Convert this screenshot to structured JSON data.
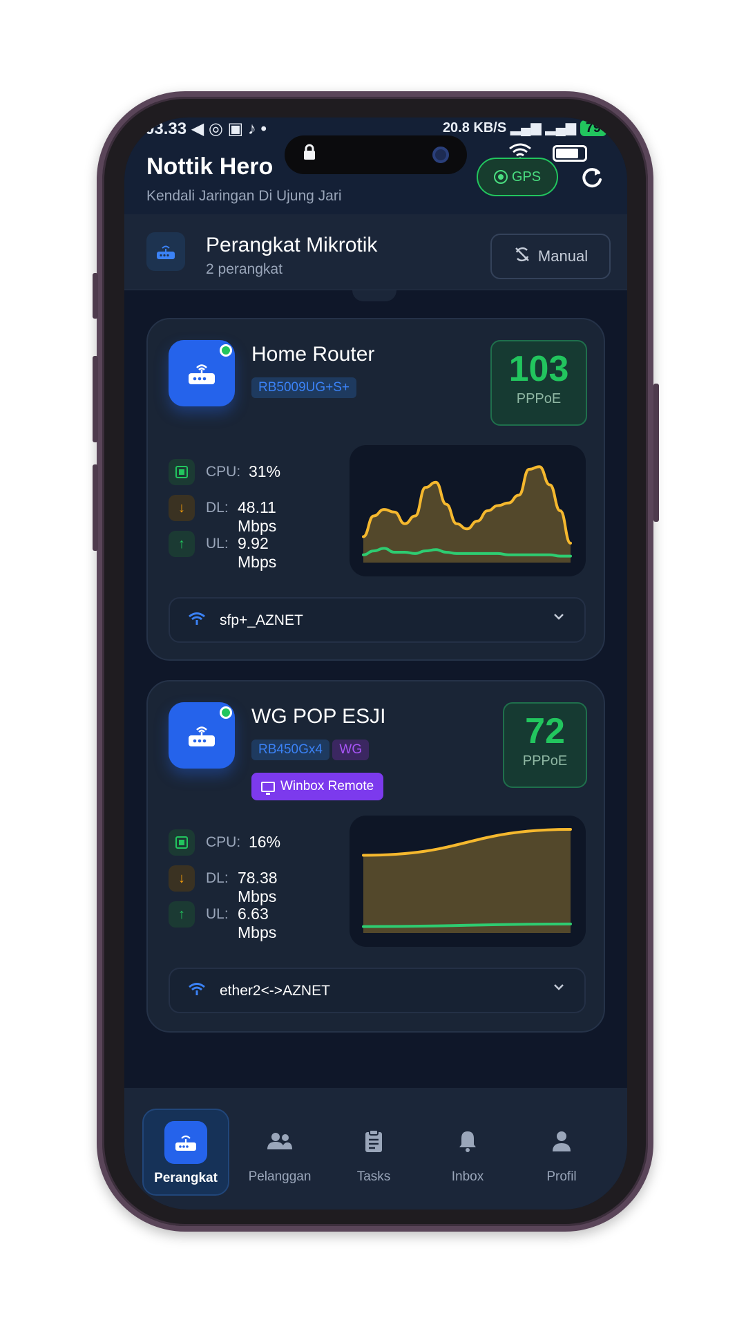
{
  "status_bar": {
    "time": "03.33",
    "speed": "20.8 KB/S",
    "battery": "79"
  },
  "header": {
    "title": "Nottik Hero",
    "subtitle": "Kendali Jaringan Di Ujung Jari",
    "gps_label": "GPS"
  },
  "section": {
    "title": "Perangkat Mikrotik",
    "subtitle": "2 perangkat",
    "manual_label": "Manual"
  },
  "devices": [
    {
      "name": "Home Router",
      "model": "RB5009UG+S+",
      "pppoe_count": "103",
      "pppoe_label": "PPPoE",
      "online": true,
      "cpu_label": "CPU:",
      "cpu": "31%",
      "dl_label": "DL:",
      "dl": "48.11 Mbps",
      "ul_label": "UL:",
      "ul": "9.92 Mbps",
      "interface": "sfp+_AZNET",
      "traffic": {
        "download": [
          20,
          36,
          41,
          39,
          30,
          36,
          58,
          62,
          45,
          30,
          26,
          32,
          40,
          44,
          46,
          52,
          72,
          74,
          60,
          40,
          15
        ],
        "upload": [
          6,
          9,
          11,
          8,
          8,
          7,
          9,
          10,
          8,
          7,
          7,
          7,
          7,
          7,
          6,
          6,
          6,
          6,
          6,
          5,
          5
        ]
      }
    },
    {
      "name": "WG POP ESJI",
      "model": "RB450Gx4",
      "tag": "WG",
      "winbox_label": "Winbox Remote",
      "pppoe_count": "72",
      "pppoe_label": "PPPoE",
      "online": true,
      "cpu_label": "CPU:",
      "cpu": "16%",
      "dl_label": "DL:",
      "dl": "78.38 Mbps",
      "ul_label": "UL:",
      "ul": "6.63 Mbps",
      "interface": "ether2<->AZNET",
      "traffic": {
        "download": [
          60,
          80
        ],
        "upload": [
          5,
          7
        ]
      }
    }
  ],
  "colors": {
    "download_line": "#f5b82e",
    "download_fill": "#6b5a2e",
    "upload_line": "#2ecc71",
    "accent": "#2563eb",
    "online": "#22c55e"
  },
  "bottom_nav": [
    {
      "label": "Perangkat",
      "icon": "router-icon",
      "active": true
    },
    {
      "label": "Pelanggan",
      "icon": "users-icon",
      "active": false
    },
    {
      "label": "Tasks",
      "icon": "clipboard-icon",
      "active": false
    },
    {
      "label": "Inbox",
      "icon": "bell-icon",
      "active": false
    },
    {
      "label": "Profil",
      "icon": "person-icon",
      "active": false
    }
  ]
}
